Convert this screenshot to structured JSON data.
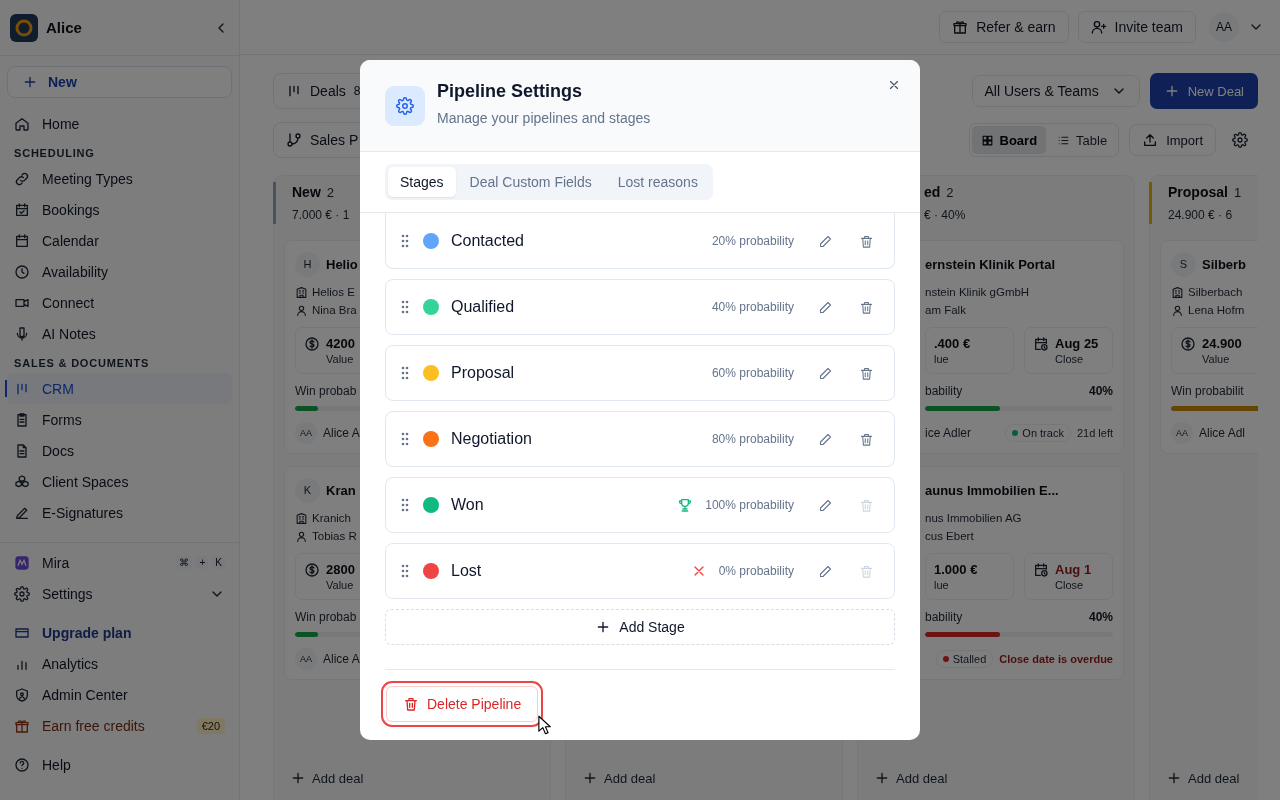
{
  "sidebar": {
    "workspace": "Alice",
    "new_button": "New",
    "sections": [
      {
        "items": [
          {
            "label": "Home",
            "selected": false
          }
        ]
      },
      {
        "heading": "SCHEDULING",
        "items": [
          {
            "label": "Meeting Types",
            "selected": false
          },
          {
            "label": "Bookings",
            "selected": false
          },
          {
            "label": "Calendar",
            "selected": false
          },
          {
            "label": "Availability",
            "selected": false
          },
          {
            "label": "Connect",
            "selected": false
          },
          {
            "label": "AI Notes",
            "selected": false
          }
        ]
      },
      {
        "heading": "SALES & DOCUMENTS",
        "items": [
          {
            "label": "CRM",
            "selected": true
          },
          {
            "label": "Forms",
            "selected": false
          },
          {
            "label": "Docs",
            "selected": false
          },
          {
            "label": "Client Spaces",
            "selected": false
          },
          {
            "label": "E-Signatures",
            "selected": false
          }
        ]
      }
    ],
    "assistant": {
      "label": "Mira",
      "shortcut": [
        "⌘",
        "+",
        "K"
      ]
    },
    "settings": "Settings",
    "footer": [
      {
        "label": "Upgrade plan",
        "kind": "upgrade"
      },
      {
        "label": "Analytics",
        "kind": "plain"
      },
      {
        "label": "Admin Center",
        "kind": "plain"
      },
      {
        "label": "Earn free credits",
        "kind": "credits",
        "badge": "€20"
      },
      {
        "label": "Help",
        "kind": "plain"
      }
    ]
  },
  "header": {
    "buttons": [
      "Refer & earn",
      "Invite team"
    ],
    "avatar": "AA"
  },
  "toolbar": {
    "view": "Deals",
    "view_count": "8",
    "pipeline": "Sales P",
    "filter": "All Users & Teams",
    "new_deal": "New Deal",
    "views": [
      {
        "label": "Board",
        "selected": true
      },
      {
        "label": "Table",
        "selected": false
      }
    ],
    "import": "Import"
  },
  "columns": [
    {
      "name": "New",
      "count": "2",
      "summary": "7.000 € · 1",
      "color": "#4a525c",
      "add": "Add deal",
      "cards": [
        {
          "initial": "H",
          "title": "Helio",
          "company": "Helios E",
          "contact": "Nina Bra",
          "value": "4200",
          "value_label": "Value",
          "prob_label": "Win probab",
          "level": 0.1,
          "color": "#0b5225",
          "owner_avatar": "AA",
          "owner": "Alice A"
        },
        {
          "initial": "K",
          "title": "Kran",
          "company": "Kranich",
          "contact": "Tobias R",
          "value": "2800",
          "value_label": "Value",
          "prob_label": "Win probab",
          "level": 0.1,
          "color": "#0b5225",
          "owner_avatar": "AA",
          "owner": "Alice A"
        }
      ]
    },
    {
      "add": "Add deal"
    },
    {
      "name": "ed",
      "count": "2",
      "summary": "€ · 40%",
      "add": "Add deal",
      "cards": [
        {
          "title": "ernstein Klinik Portal",
          "company": "nstein Klinik gGmbH",
          "contact": "am Falk",
          "value": ".400 €",
          "value_label": "lue",
          "close": "Aug 25",
          "close_label": "Close",
          "overdue": false,
          "prob_label": "bability",
          "prob": "40%",
          "level": 0.4,
          "color": "#0b5225",
          "owner": "ice Adler",
          "status": {
            "label": "On track",
            "color": "#085d41"
          },
          "note": "21d left",
          "alert": false
        },
        {
          "title": "aunus Immobilien E...",
          "company": "nus Immobilien AG",
          "contact": "cus Ebert",
          "value": "1.000 €",
          "value_label": "lue",
          "close": "Aug 1",
          "close_label": "Close",
          "overdue": true,
          "prob_label": "bability",
          "prob": "40%",
          "level": 0.4,
          "color": "#6e1313",
          "status": {
            "label": "Stalled",
            "color": "#6e1313"
          },
          "note": "Close date is overdue",
          "alert": true
        }
      ]
    },
    {
      "name": "Proposal",
      "count": "1",
      "summary": "24.900 € · 6",
      "color": "#755a04",
      "add": "Add deal",
      "cards": [
        {
          "initial": "S",
          "title": "Silberb",
          "company": "Silberbach",
          "contact": "Lena Hofm",
          "value": "24.900",
          "value_label": "Value",
          "prob_label": "Win probabilit",
          "level": 0.6,
          "color": "#654502",
          "owner_avatar": "AA",
          "owner": "Alice Adl"
        }
      ]
    }
  ],
  "dialog": {
    "title": "Pipeline Settings",
    "subtitle": "Manage your pipelines and stages",
    "tabs": [
      {
        "label": "Stages",
        "selected": true
      },
      {
        "label": "Deal Custom Fields",
        "selected": false
      },
      {
        "label": "Lost reasons",
        "selected": false
      }
    ],
    "stages": [
      {
        "name": "Contacted",
        "color": "#60a5fa",
        "probability": "20% probability",
        "kind": "open",
        "deletable": true
      },
      {
        "name": "Qualified",
        "color": "#34d399",
        "probability": "40% probability",
        "kind": "open",
        "deletable": true
      },
      {
        "name": "Proposal",
        "color": "#fbbf24",
        "probability": "60% probability",
        "kind": "open",
        "deletable": true
      },
      {
        "name": "Negotiation",
        "color": "#f97316",
        "probability": "80% probability",
        "kind": "open",
        "deletable": true
      },
      {
        "name": "Won",
        "color": "#10b981",
        "probability": "100% probability",
        "kind": "won",
        "deletable": false
      },
      {
        "name": "Lost",
        "color": "#ef4444",
        "probability": "0% probability",
        "kind": "lost",
        "deletable": false
      }
    ],
    "add_stage": "Add Stage",
    "delete_button": "Delete Pipeline",
    "delete_focused": true
  }
}
